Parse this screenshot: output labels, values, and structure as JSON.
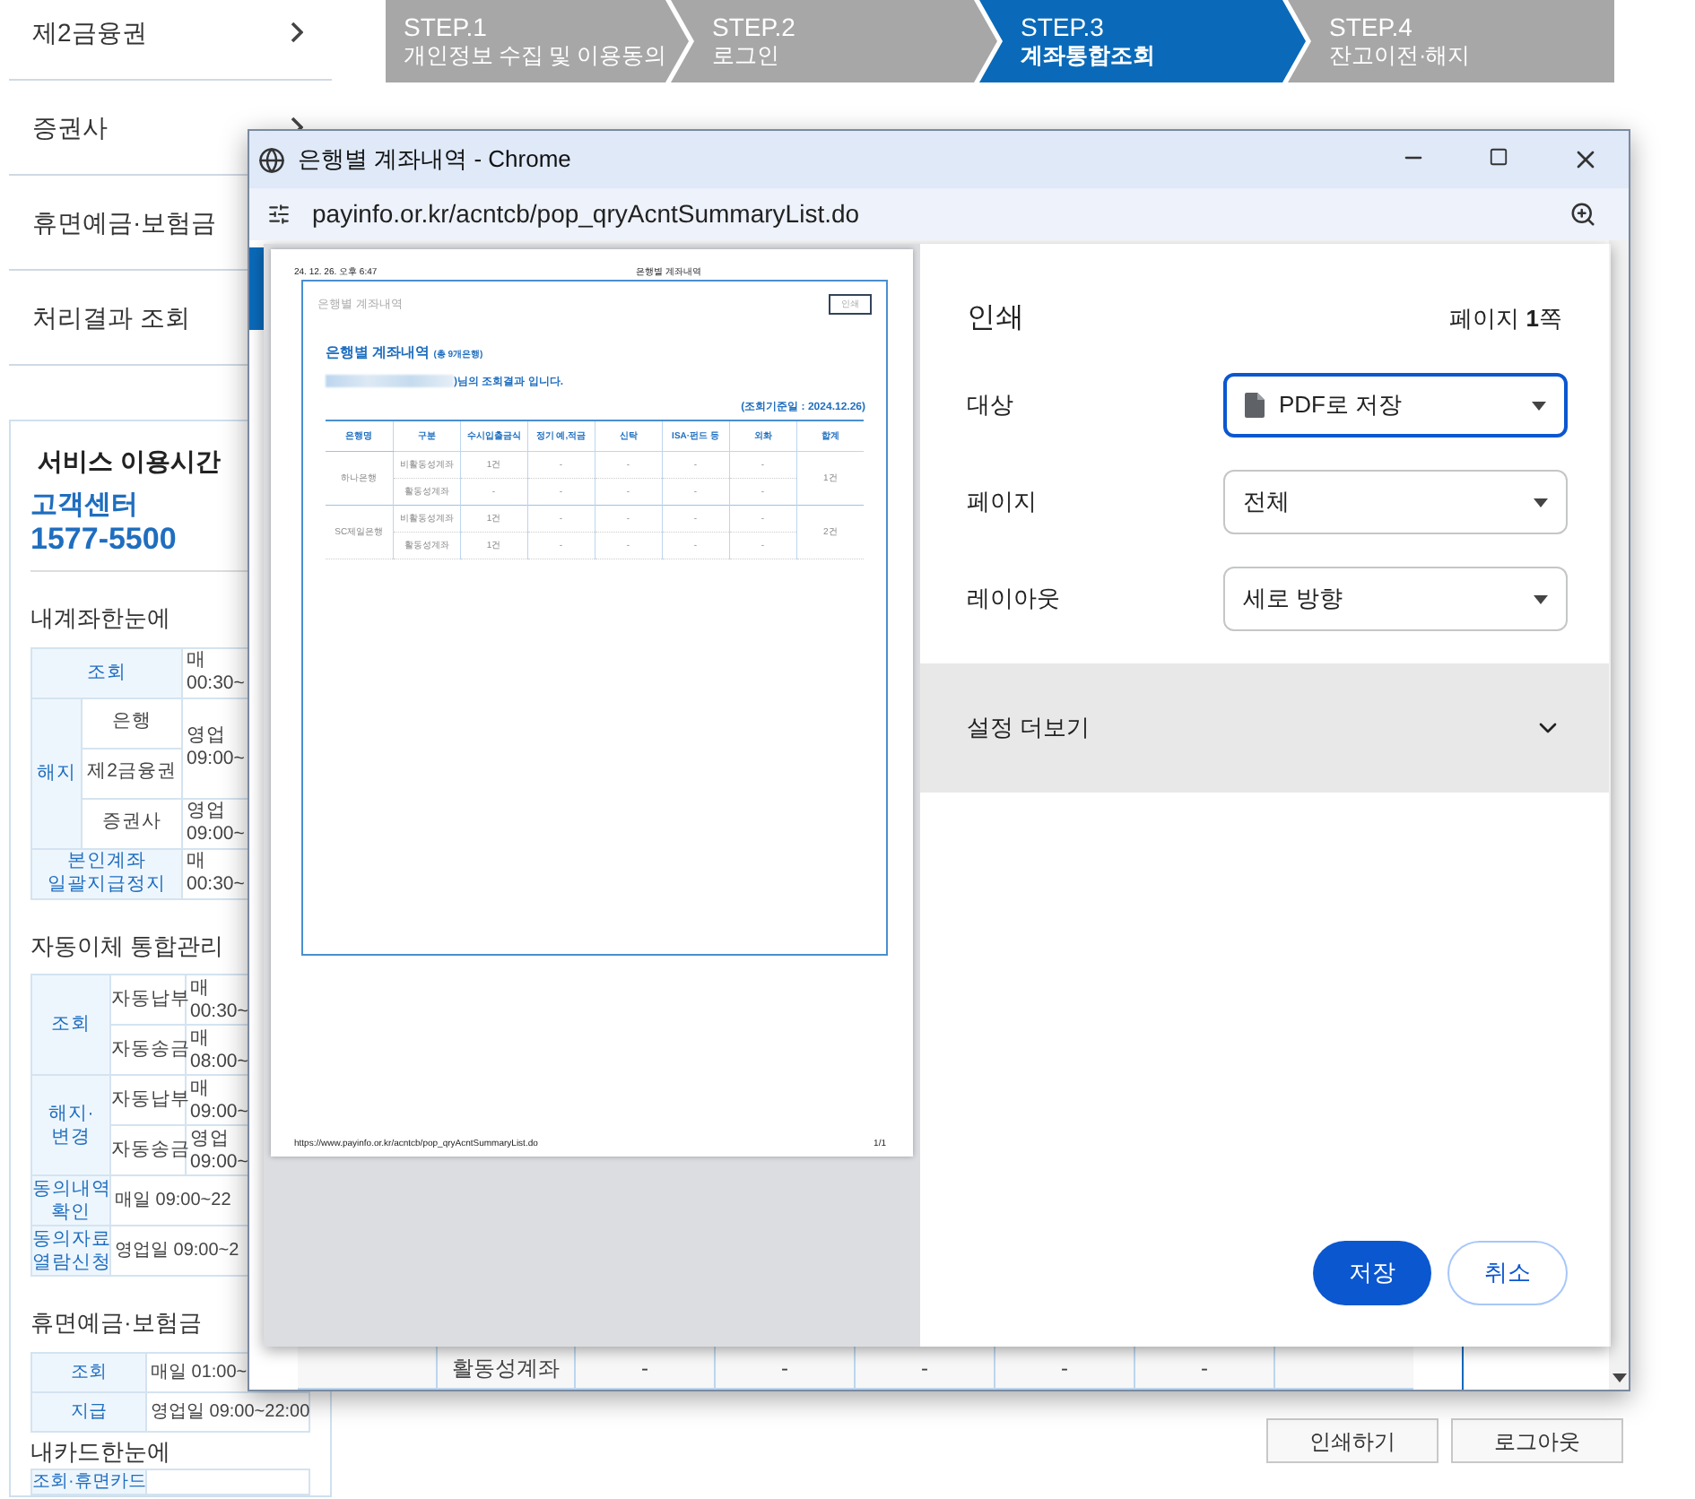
{
  "sidebar": {
    "menu": [
      {
        "label": "제2금융권",
        "arrow": true
      },
      {
        "label": "증권사",
        "arrow": true
      },
      {
        "label": "휴면예금·보험금"
      },
      {
        "label": "처리결과 조회"
      }
    ],
    "service_hours": {
      "title": "서비스 이용시간",
      "center_label": "고객센터",
      "phone": "1577-5500",
      "sections": [
        {
          "title": "내계좌한눈에",
          "label_span": true,
          "groups": [
            {
              "label": "조회",
              "time": [
                "매",
                "00:30~"
              ]
            },
            {
              "label": "해지",
              "rows": [
                {
                  "items": [
                    "은행",
                    "제2금융권"
                  ],
                  "time": [
                    "영업",
                    "09:00~"
                  ]
                },
                {
                  "items": [
                    "증권사"
                  ],
                  "time": [
                    "영업",
                    "09:00~"
                  ]
                }
              ]
            },
            {
              "label": "본인계좌 일괄지급정지",
              "time": [
                "매",
                "00:30~"
              ]
            }
          ]
        },
        {
          "title": "자동이체 통합관리",
          "label_span": false,
          "groups": [
            {
              "label": "조회",
              "rows": [
                {
                  "items": [
                    "자동납부"
                  ],
                  "time": [
                    "매",
                    "00:30~"
                  ]
                },
                {
                  "items": [
                    "자동송금"
                  ],
                  "time": [
                    "매",
                    "08:00~"
                  ]
                }
              ]
            },
            {
              "label": "해지·변경",
              "rows": [
                {
                  "items": [
                    "자동납부"
                  ],
                  "time": [
                    "매",
                    "09:00~"
                  ]
                },
                {
                  "items": [
                    "자동송금"
                  ],
                  "time": [
                    "영업",
                    "09:00~"
                  ]
                }
              ]
            },
            {
              "label": "동의내역 확인",
              "time": [
                "매일 09:00~22"
              ]
            },
            {
              "label": "동의자료 열람신청",
              "time": [
                "영업일 09:00~2"
              ]
            }
          ]
        },
        {
          "title": "휴면예금·보험금",
          "groups": [
            {
              "label": "조회",
              "time": [
                "매일 01:00~"
              ]
            },
            {
              "label": "지급",
              "time": [
                "영업일 09:00~22:00"
              ]
            }
          ]
        },
        {
          "title": "내카드한눈에",
          "groups": [
            {
              "label": "조회·휴면카드"
            }
          ]
        }
      ]
    }
  },
  "steps": [
    {
      "number": "STEP.1",
      "label": "개인정보 수집 및 이용동의",
      "selected": false
    },
    {
      "number": "STEP.2",
      "label": "로그인",
      "selected": false
    },
    {
      "number": "STEP.3",
      "label": "계좌통합조회",
      "selected": true
    },
    {
      "number": "STEP.4",
      "label": "잔고이전·해지",
      "selected": false
    }
  ],
  "popup": {
    "title": "은행별 계좌내역 - Chrome",
    "url": "payinfo.or.kr/acntcb/pop_qryAcntSummaryList.do",
    "background_row": {
      "label": "활동성계좌",
      "cells": [
        "-",
        "-",
        "-",
        "-",
        "-"
      ]
    },
    "print_dialog": {
      "title": "인쇄",
      "page_count": "페이지 **1**쪽",
      "preview": {
        "header_date": "24. 12. 26. 오후 6:47",
        "header_title": "은행별 계좌내역",
        "box_title": "은행별 계좌내역",
        "print_button": "인쇄",
        "heading": "은행별 계좌내역",
        "heading_note": "(총 9개은행)",
        "result_text": ")님의 조회결과 입니다.",
        "as_of": "(조회기준일 : 2024.12.26)",
        "columns": [
          "은행명",
          "구분",
          "수시입출금식",
          "정기 예,적금",
          "신탁",
          "ISA·펀드 등",
          "외화",
          "합계"
        ],
        "banks": [
          {
            "name": "하나은행",
            "total": "1건",
            "rows": [
              {
                "type": "비활동성계좌",
                "cells": [
                  "1건",
                  "-",
                  "-",
                  "-",
                  "-"
                ]
              },
              {
                "type": "활동성계좌",
                "cells": [
                  "-",
                  "-",
                  "-",
                  "-",
                  "-"
                ]
              }
            ]
          },
          {
            "name": "SC제일은행",
            "total": "2건",
            "rows": [
              {
                "type": "비활동성계좌",
                "cells": [
                  "1건",
                  "-",
                  "-",
                  "-",
                  "-"
                ]
              },
              {
                "type": "활동성계좌",
                "cells": [
                  "1건",
                  "-",
                  "-",
                  "-",
                  "-"
                ]
              }
            ]
          }
        ],
        "footer_url": "https://www.payinfo.or.kr/acntcb/pop_qryAcntSummaryList.do",
        "footer_page": "1/1"
      },
      "settings": [
        {
          "label": "대상",
          "value": "PDF로 저장",
          "kind": "destination",
          "focused": true
        },
        {
          "label": "페이지",
          "value": "전체",
          "kind": "plain",
          "focused": false
        },
        {
          "label": "레이아웃",
          "value": "세로 방향",
          "kind": "plain",
          "focused": false
        }
      ],
      "more_settings": {
        "label": "설정 더보기",
        "expanded": false
      },
      "buttons": [
        {
          "label": "저장",
          "kind": "primary"
        },
        {
          "label": "취소",
          "kind": "secondary"
        }
      ]
    }
  },
  "page_buttons": [
    {
      "label": "인쇄하기"
    },
    {
      "label": "로그아웃"
    }
  ]
}
